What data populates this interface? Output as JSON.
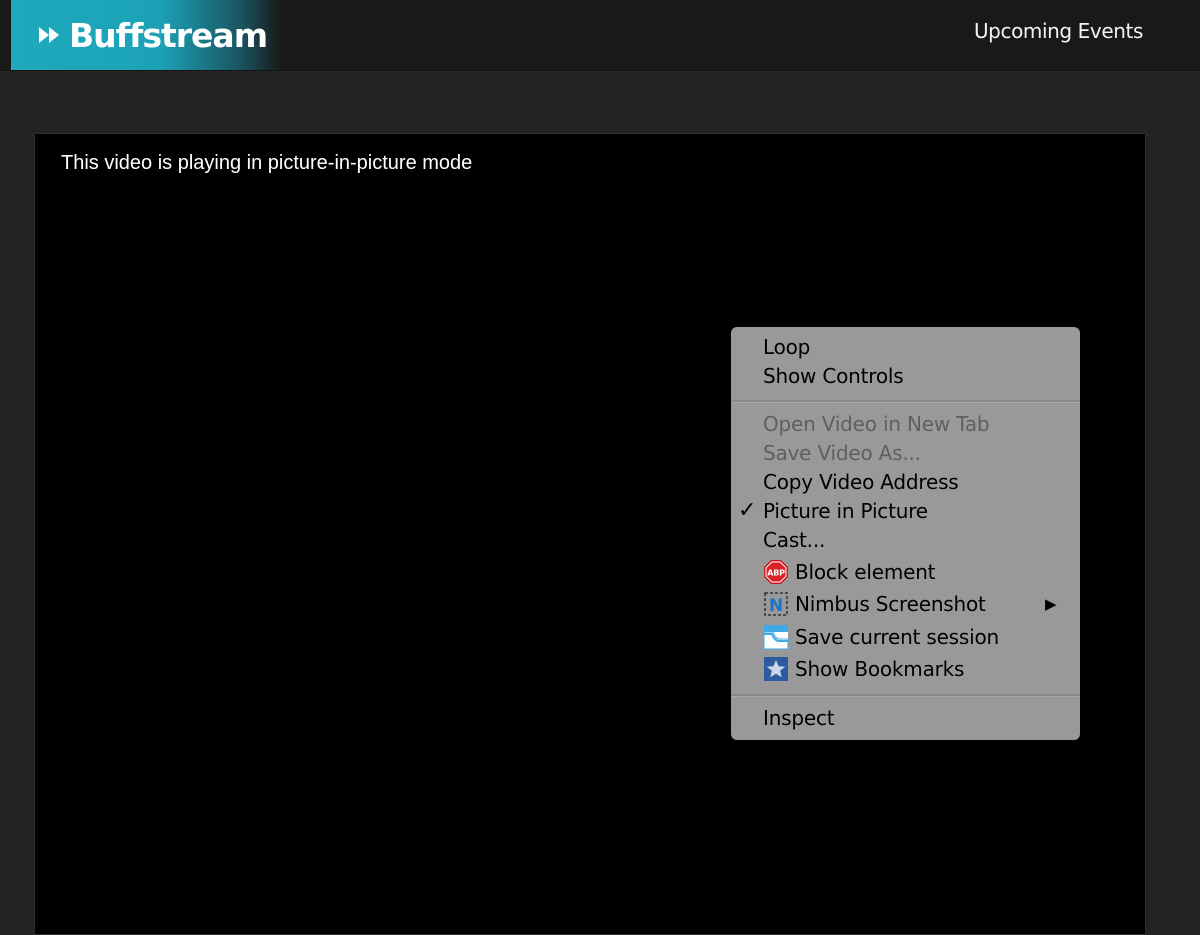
{
  "header": {
    "logo_text": "Buffstream",
    "logo_icon": "fast-forward-icon",
    "nav_link": "Upcoming Events",
    "accent_color": "#1ea9bd"
  },
  "player": {
    "message": "This video is playing in picture-in-picture mode"
  },
  "context_menu": {
    "loop": "Loop",
    "show_controls": "Show Controls",
    "open_video_new_tab": "Open Video in New Tab",
    "save_video_as": "Save Video As...",
    "copy_video_address": "Copy Video Address",
    "picture_in_picture": "Picture in Picture",
    "picture_in_picture_checked": true,
    "cast": "Cast...",
    "block_element": "Block element",
    "nimbus_screenshot": "Nimbus Screenshot",
    "save_current_session": "Save current session",
    "show_bookmarks": "Show Bookmarks",
    "inspect": "Inspect",
    "checkmark_glyph": "✓",
    "submenu_glyph": "▶",
    "icons": {
      "block_element": "adblock-icon",
      "nimbus_screenshot": "nimbus-icon",
      "save_current_session": "session-icon",
      "show_bookmarks": "bookmark-star-icon"
    },
    "abp_text": "ABP",
    "nimbus_letter": "N"
  }
}
